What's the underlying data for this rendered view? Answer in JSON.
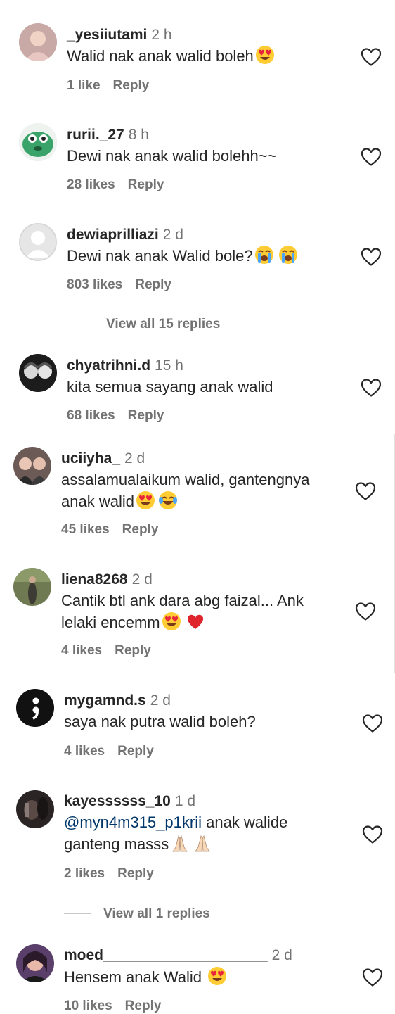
{
  "comments": [
    {
      "username": "_yesiiutami",
      "time": "2 h",
      "text": "Walid nak anak walid boleh",
      "emoji_end": "heart-eyes-emoji",
      "likes": "1 like",
      "reply": "Reply"
    },
    {
      "username": "rurii._27",
      "time": "8 h",
      "text": "Dewi nak anak walid bolehh~~",
      "likes": "28 likes",
      "reply": "Reply"
    },
    {
      "username": "dewiaprilliazi",
      "time": "2 d",
      "text": "Dewi nak anak Walid bole?",
      "emoji_end": "loudly-crying-emoji x2",
      "likes": "803 likes",
      "reply": "Reply",
      "view_replies": "View all 15 replies"
    },
    {
      "username": "chyatrihni.d",
      "time": "15 h",
      "text": "kita semua sayang anak walid",
      "likes": "68 likes",
      "reply": "Reply"
    },
    {
      "username": "uciiyha_",
      "time": "2 d",
      "text_line1": "assalamualaikum walid, gantengnya",
      "text_line2": "anak walid",
      "emoji_end": "heart-eyes-emoji, tears-of-joy-emoji",
      "likes": "45 likes",
      "reply": "Reply"
    },
    {
      "username": "liena8268",
      "time": "2 d",
      "text_line1": "Cantik btl ank dara abg faizal... Ank",
      "text_line2": "lelaki encemm",
      "emoji_end": "heart-eyes-emoji, red-heart-emoji",
      "likes": "4 likes",
      "reply": "Reply"
    },
    {
      "username": "mygamnd.s",
      "time": "2 d",
      "text": "saya nak putra walid boleh?",
      "likes": "4 likes",
      "reply": "Reply"
    },
    {
      "username": "kayessssss_10",
      "time": "1 d",
      "mention": "@myn4m315_p1krii",
      "text_line1_rest": " anak walide",
      "text_line2": "ganteng masss",
      "emoji_end": "folded-hands-emoji x2",
      "likes": "2 likes",
      "reply": "Reply",
      "view_replies": "View all 1 replies"
    },
    {
      "username": "moed____________________",
      "time": "2 d",
      "text": "Hensem anak Walid ",
      "emoji_end": "heart-eyes-emoji",
      "likes": "10 likes",
      "reply": "Reply"
    }
  ],
  "colors": {
    "text": "#262626",
    "muted": "#737373",
    "mention": "#00376b"
  }
}
